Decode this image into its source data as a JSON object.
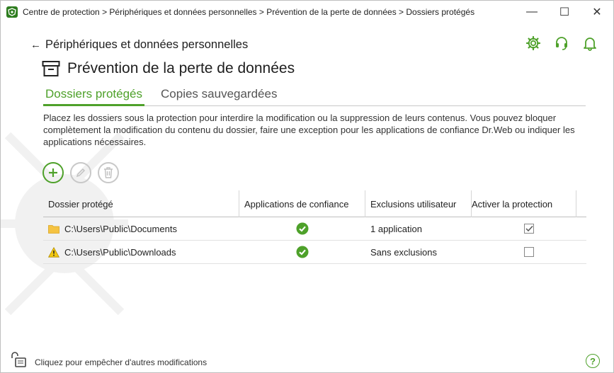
{
  "window": {
    "title": "Centre de protection > Périphériques et données personnelles > Prévention de la perte de données > Dossiers protégés",
    "minimize_glyph": "—",
    "maximize_glyph": "☐",
    "close_glyph": "✕"
  },
  "nav": {
    "back_label": "Périphériques et données personnelles"
  },
  "page": {
    "title": "Prévention de la perte de données"
  },
  "tabs": [
    {
      "label": "Dossiers protégés",
      "active": true
    },
    {
      "label": "Copies sauvegardées",
      "active": false
    }
  ],
  "description": "Placez les dossiers sous la protection pour interdire la modification ou la suppression de leurs contenus. Vous pouvez bloquer complètement la modification du contenu du dossier, faire une exception pour les applications de confiance Dr.Web ou indiquer les applications nécessaires.",
  "table": {
    "headers": [
      "Dossier protégé",
      "Applications de confiance",
      "Exclusions utilisateur",
      "Activer la protection"
    ],
    "rows": [
      {
        "folder": "C:\\Users\\Public\\Documents",
        "icon": "folder-icon",
        "trusted_apps": "check-icon",
        "exclusions": "1 application",
        "protection_enabled": true
      },
      {
        "folder": "C:\\Users\\Public\\Downloads",
        "icon": "warning-icon",
        "trusted_apps": "check-icon",
        "exclusions": "Sans exclusions",
        "protection_enabled": false
      }
    ]
  },
  "footer": {
    "lock_text": "Cliquez pour empêcher d'autres modifications",
    "help_glyph": "?"
  },
  "colors": {
    "accent": "#4ea12a",
    "folder": "#f5c342",
    "warning": "#f2c811"
  }
}
